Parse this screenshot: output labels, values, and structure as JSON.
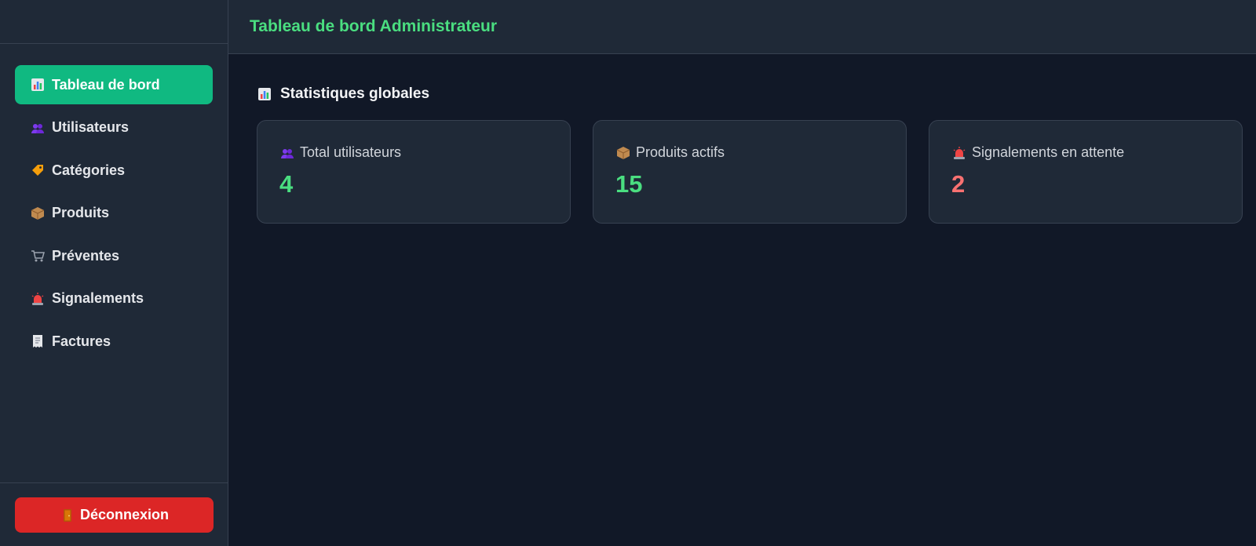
{
  "header": {
    "title": "Tableau de bord Administrateur"
  },
  "sidebar": {
    "items": [
      {
        "label": "Tableau de bord",
        "icon": "bar-chart-icon",
        "active": true
      },
      {
        "label": "Utilisateurs",
        "icon": "users-icon"
      },
      {
        "label": "Catégories",
        "icon": "tag-icon"
      },
      {
        "label": "Produits",
        "icon": "package-icon"
      },
      {
        "label": "Préventes",
        "icon": "cart-icon"
      },
      {
        "label": "Signalements",
        "icon": "siren-icon"
      },
      {
        "label": "Factures",
        "icon": "receipt-icon"
      }
    ],
    "logout_label": "Déconnexion",
    "logout_icon": "door-icon"
  },
  "main": {
    "section_title": "Statistiques globales",
    "stats": [
      {
        "label": "Total utilisateurs",
        "value": "4",
        "icon": "users-icon",
        "color": "#4ade80"
      },
      {
        "label": "Produits actifs",
        "value": "15",
        "icon": "package-icon",
        "color": "#4ade80"
      },
      {
        "label": "Signalements en attente",
        "value": "2",
        "icon": "siren-icon",
        "color": "#f87171"
      }
    ]
  },
  "colors": {
    "accent": "#10b981",
    "danger": "#dc2626",
    "title_green": "#4ade80",
    "alert_red": "#f87171"
  }
}
